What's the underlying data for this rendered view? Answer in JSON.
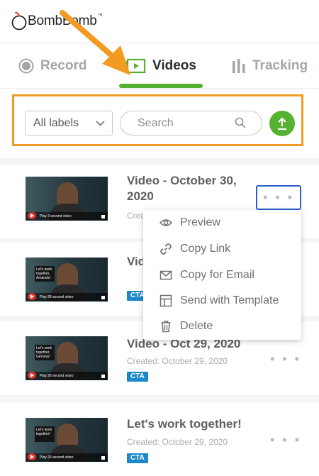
{
  "brand": {
    "name": "BombBomb",
    "tm": "™"
  },
  "tabs": [
    {
      "label": "Record",
      "icon": "record-icon"
    },
    {
      "label": "Videos",
      "icon": "video-icon",
      "active": true
    },
    {
      "label": "Tracking",
      "icon": "bar-chart-icon"
    }
  ],
  "filters": {
    "labels_select": "All labels",
    "search_placeholder": "Search"
  },
  "videos": [
    {
      "title_line1": "Video - October 30,",
      "title_line2": "2020",
      "created": "Creat",
      "cta": "",
      "thumb_caption": "Play 3 second video",
      "thumb_sign": ""
    },
    {
      "title_line1": "Vid",
      "created": "",
      "cta": "CTA",
      "thumb_caption": "Play 28 second video",
      "thumb_sign": "Let's work together, Amanda!"
    },
    {
      "title_line1": "Video - Oct 29, 2020",
      "created": "Created: October 29, 2020",
      "cta": "CTA",
      "thumb_caption": "Play 28 second video",
      "thumb_sign": "Let's work together, Gemma!"
    },
    {
      "title_line1": "Let's work together!",
      "created": "Created: October 29, 2020",
      "cta": "CTA",
      "thumb_caption": "Play 26 second video",
      "thumb_sign": "Let's work together!"
    }
  ],
  "more_label": "• • •",
  "context_menu": [
    {
      "label": "Preview",
      "icon": "eye-icon"
    },
    {
      "label": "Copy Link",
      "icon": "link-icon"
    },
    {
      "label": "Copy for Email",
      "icon": "envelope-icon"
    },
    {
      "label": "Send with Template",
      "icon": "template-icon"
    },
    {
      "label": "Delete",
      "icon": "trash-icon"
    }
  ],
  "colors": {
    "accent_green": "#55b130",
    "highlight_orange": "#f39a22",
    "cta_blue": "#1a88c9",
    "focus_blue": "#2b5fcf"
  }
}
